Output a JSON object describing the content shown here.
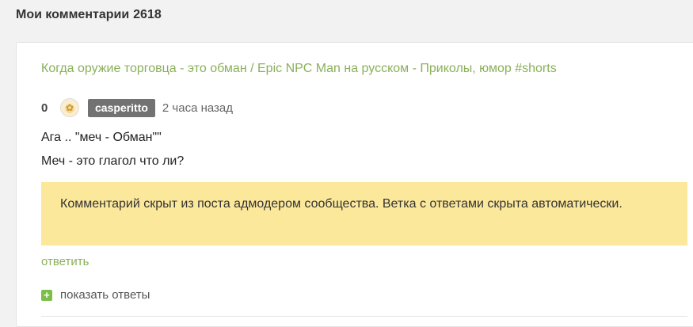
{
  "header": {
    "title": "Мои комментарии",
    "count": "2618"
  },
  "comment": {
    "post_title": "Когда оружие торговца - это обман / Epic NPC Man на русском - Приколы, юмор #shorts",
    "rating": "0",
    "username": "casperitto",
    "time": "2 часа назад",
    "text_line_1": "Ага .. \"меч - Обман\"\"",
    "text_line_2": "Меч - это глагол что ли?",
    "notice": "Комментарий скрыт из поста адмодером сообщества. Ветка с ответами скрыта автоматически.",
    "reply_label": "ответить",
    "show_replies_label": "показать ответы"
  },
  "colors": {
    "link": "#8ab059",
    "notice_bg": "#fbe89b",
    "username_bg": "#727272",
    "plus_icon": "#7bbf4a"
  },
  "icons": {
    "avatar": "avatar-icon",
    "plus": "plus-icon"
  }
}
